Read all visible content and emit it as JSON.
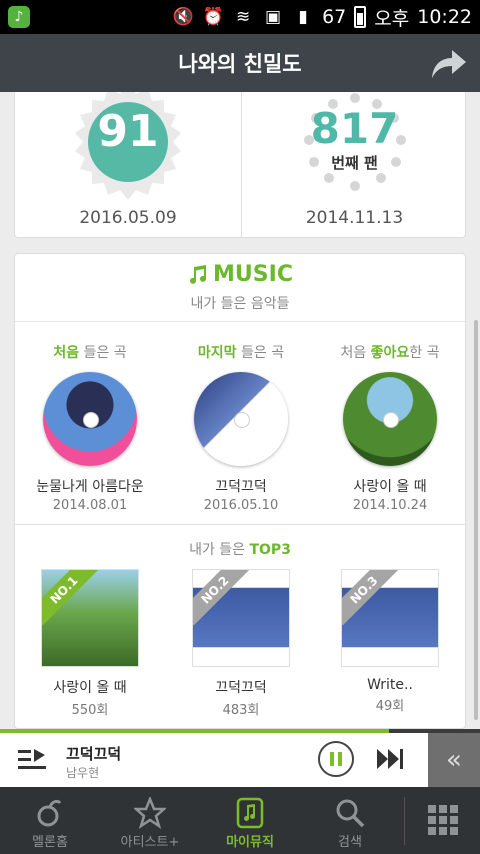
{
  "status": {
    "battery": "67",
    "ampm": "오후",
    "time": "10:22"
  },
  "header": {
    "title": "나와의 친밀도"
  },
  "stats": {
    "temperature": {
      "value": "91",
      "date": "2016.05.09"
    },
    "fan": {
      "value": "817",
      "label": "번째 팬",
      "date": "2014.11.13"
    }
  },
  "music": {
    "title": "MUSIC",
    "subtitle": "내가 들은 음악들",
    "firsts": [
      {
        "label_hl": "처음",
        "label_rest": " 들은 곡",
        "song": "눈물나게 아름다운",
        "date": "2014.08.01"
      },
      {
        "label_hl": "마지막",
        "label_rest": " 들은 곡",
        "song": "끄덕끄덕",
        "date": "2016.05.10"
      },
      {
        "label_pre": "처음 ",
        "label_hl": "좋아요",
        "label_rest": "한 곡",
        "song": "사랑이 올 때",
        "date": "2014.10.24"
      }
    ],
    "top3_head_pre": "내가 들은 ",
    "top3_head_hl": "TOP3",
    "top3": [
      {
        "rank": "NO.1",
        "song": "사랑이 올 때",
        "plays": "550회"
      },
      {
        "rank": "NO.2",
        "song": "끄덕끄덕",
        "plays": "483회"
      },
      {
        "rank": "NO.3",
        "song": "Write..",
        "plays": "49회"
      }
    ]
  },
  "now_playing": {
    "title": "끄덕끄덕",
    "artist": "남우현",
    "progress": 0.81
  },
  "nav": [
    {
      "label": "멜론홈",
      "icon": "melon-home-icon"
    },
    {
      "label": "아티스트+",
      "icon": "star-icon"
    },
    {
      "label": "마이뮤직",
      "icon": "my-music-icon",
      "active": true
    },
    {
      "label": "검색",
      "icon": "search-icon"
    }
  ],
  "colors": {
    "accent": "#7dbb2c",
    "teal": "#4fb8a6",
    "header": "#3e4449",
    "nav": "#2f3336"
  }
}
